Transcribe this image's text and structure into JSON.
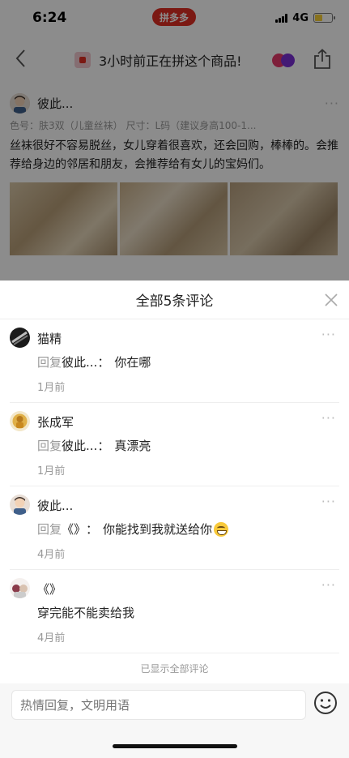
{
  "status_bar": {
    "time": "6:24",
    "brand": "拼多多",
    "network": "4G",
    "battery_level": 0.45
  },
  "nav": {
    "title": "3小时前正在拼这个商品!"
  },
  "background_review": {
    "user": "彼此...",
    "spec": "色号：肤3双（儿童丝袜）   尺寸：L码（建议身高100-1...",
    "text": "丝袜很好不容易脱丝，女儿穿着很喜欢，还会回购，棒棒的。会推荐给身边的邻居和朋友，会推荐给有女儿的宝妈们。"
  },
  "sheet": {
    "title": "全部5条评论",
    "end_note": "已显示全部评论",
    "input_placeholder": "热情回复，文明用语"
  },
  "comments": [
    {
      "name": "猫精",
      "reply_word": "回复",
      "reply_target": "彼此...",
      "sep": "：",
      "text": "你在哪",
      "time": "1月前"
    },
    {
      "name": "张成军",
      "reply_word": "回复",
      "reply_target": "彼此...",
      "sep": "：",
      "text": "真漂亮",
      "time": "1月前"
    },
    {
      "name": "彼此...",
      "reply_word": "回复",
      "reply_target": "《》",
      "sep": "：",
      "text": "你能找到我就送给你",
      "time": "4月前"
    },
    {
      "name": "《》",
      "text": "穿完能不能卖给我",
      "time": "4月前"
    }
  ],
  "colors": {
    "brand": "#e02e24",
    "muted": "#999999"
  }
}
